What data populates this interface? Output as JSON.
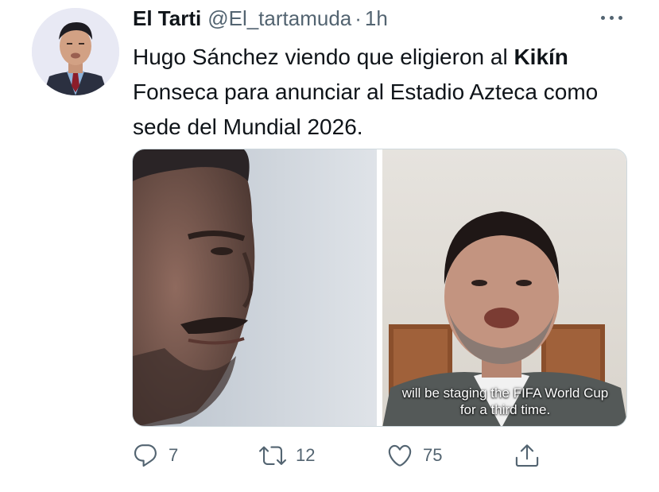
{
  "tweet": {
    "author_name": "El Tarti",
    "author_handle": "@El_tartamuda",
    "separator": "·",
    "time": "1h",
    "text_parts": {
      "before": "Hugo Sánchez viendo que eligieron al ",
      "bold": "Kikín",
      "after": " Fonseca para anunciar al Estadio Azteca como sede del Mundial 2026."
    }
  },
  "media": {
    "caption_line1": "will be staging the FIFA World Cup",
    "caption_line2": "for a third time."
  },
  "actions": {
    "replies": "7",
    "retweets": "12",
    "likes": "75"
  },
  "icons": {
    "more": "more-horizontal-icon",
    "reply": "reply-icon",
    "retweet": "retweet-icon",
    "like": "heart-icon",
    "share": "share-icon"
  },
  "colors": {
    "text": "#0f1419",
    "secondary": "#536471",
    "border": "#cfd9de"
  }
}
